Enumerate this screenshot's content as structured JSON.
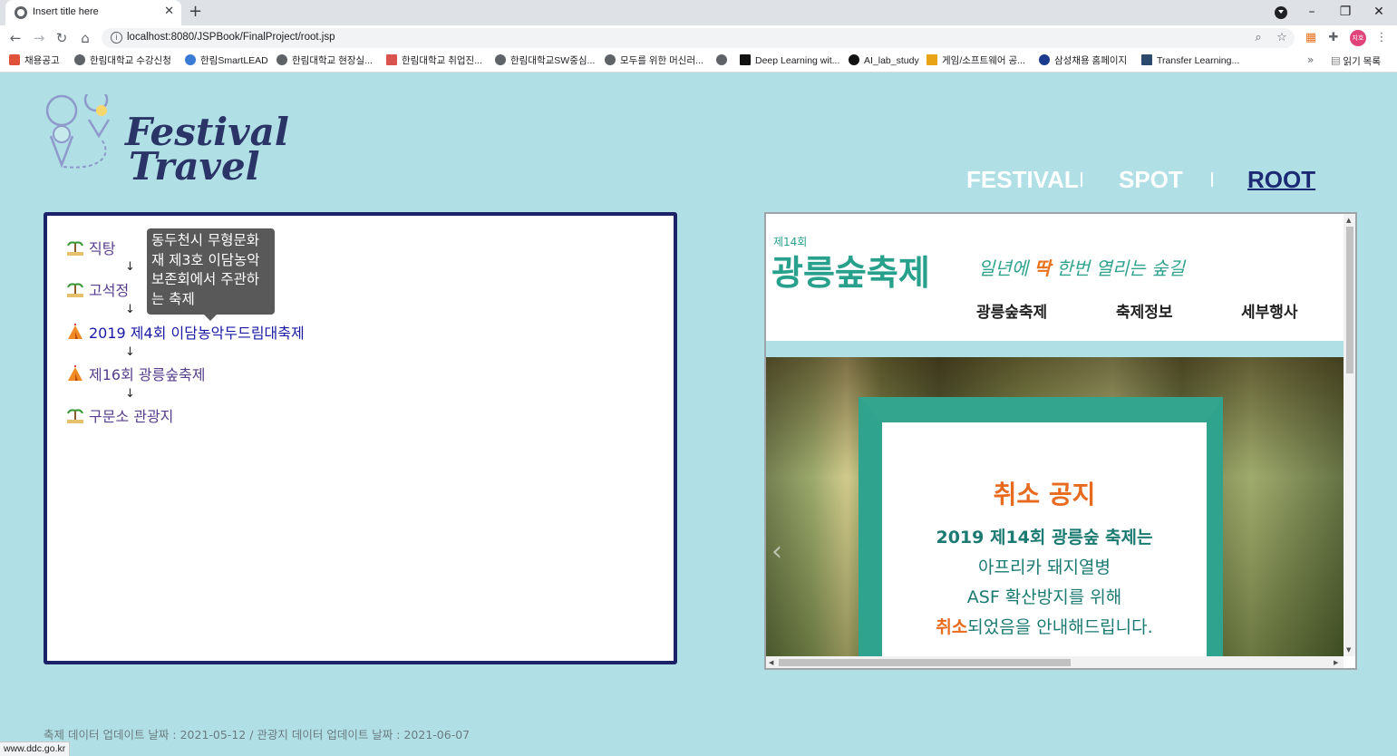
{
  "browser": {
    "tab_title": "Insert title here",
    "url": "localhost:8080/JSPBook/FinalProject/root.jsp",
    "avatar_label": "지호",
    "bookmarks": [
      "채용공고",
      "한림대학교 수강신청",
      "한림SmartLEAD",
      "한림대학교 현장실...",
      "한림대학교 취업진...",
      "한림대학교SW중심...",
      "모두를 위한 머신러...",
      "",
      "Deep Learning wit...",
      "AI_lab_study",
      "게임/소프트웨어 공...",
      "삼성채용 홈페이지",
      "Transfer Learning..."
    ],
    "reading_list": "읽기 목록",
    "status_url": "www.ddc.go.kr"
  },
  "logo": {
    "line1": "Festival",
    "line2": "Travel"
  },
  "nav": {
    "festival": "FESTIVAL",
    "spot": "SPOT",
    "root": "ROOT"
  },
  "route": {
    "items": [
      "직탕",
      "고석정",
      "2019 제4회 이담농악두드림대축제",
      "제16회 광릉숲축제",
      "구문소 관광지"
    ],
    "arrow": "↓",
    "tooltip": "동두천시 무형문화재 제3호 이담농악보존회에서 주관하는 축제"
  },
  "preview": {
    "logo_small": "제14회",
    "logo_main": "광릉숲축제",
    "slogan_pre": "일년에 ",
    "slogan_bold": "딱",
    "slogan_post": " 한번 열리는 숲길",
    "menu": [
      "광릉숲축제",
      "축제정보",
      "세부행사"
    ],
    "notice_title": "취소 공지",
    "notice_line1": "2019 제14회 광릉숲 축제는",
    "notice_line2": "아프리카 돼지열병",
    "notice_line3": "ASF 확산방지를 위해",
    "notice_line4_hl": "취소",
    "notice_line4_rest": "되었음을 안내해드립니다."
  },
  "footer": "축제 데이터 업데이트 날짜 : 2021-05-12 / 관광지 데이터 업데이트 날짜 : 2021-06-07",
  "colors": {
    "page_bg": "#b0dfe5",
    "panel_border": "#1c2268",
    "active_nav": "#1c2a74",
    "accent_green": "#2fa38d",
    "accent_orange": "#e86a1e"
  }
}
